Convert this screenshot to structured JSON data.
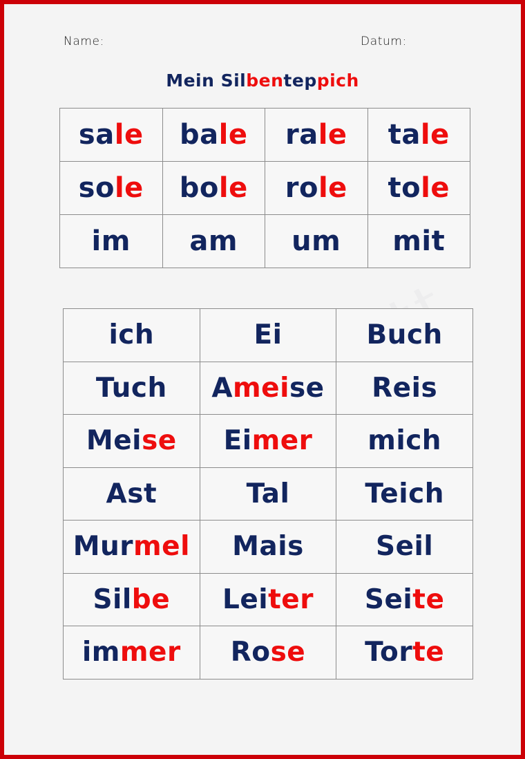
{
  "colors": {
    "page_border": "#cc0007",
    "page_background": "#f4f4f4",
    "syllable_primary": "#12255e",
    "syllable_secondary": "#ee0d0d",
    "grid_line": "#8c8c8c"
  },
  "header": {
    "name_label": "Name:",
    "date_label": "Datum:"
  },
  "title": {
    "full_text": "Mein Silbenteppich",
    "segments": [
      {
        "text": "Mein ",
        "color": "primary"
      },
      {
        "text": "Sil",
        "color": "primary"
      },
      {
        "text": "ben",
        "color": "secondary"
      },
      {
        "text": "tep",
        "color": "primary"
      },
      {
        "text": "pich",
        "color": "secondary"
      }
    ]
  },
  "tables": [
    {
      "id": "syllables",
      "columns": 4,
      "rows": [
        [
          {
            "word": "sale",
            "segments": [
              {
                "text": "sa",
                "color": "primary"
              },
              {
                "text": "le",
                "color": "secondary"
              }
            ]
          },
          {
            "word": "bale",
            "segments": [
              {
                "text": "ba",
                "color": "primary"
              },
              {
                "text": "le",
                "color": "secondary"
              }
            ]
          },
          {
            "word": "rale",
            "segments": [
              {
                "text": "ra",
                "color": "primary"
              },
              {
                "text": "le",
                "color": "secondary"
              }
            ]
          },
          {
            "word": "tale",
            "segments": [
              {
                "text": "ta",
                "color": "primary"
              },
              {
                "text": "le",
                "color": "secondary"
              }
            ]
          }
        ],
        [
          {
            "word": "sole",
            "segments": [
              {
                "text": "so",
                "color": "primary"
              },
              {
                "text": "le",
                "color": "secondary"
              }
            ]
          },
          {
            "word": "bole",
            "segments": [
              {
                "text": "bo",
                "color": "primary"
              },
              {
                "text": "le",
                "color": "secondary"
              }
            ]
          },
          {
            "word": "role",
            "segments": [
              {
                "text": "ro",
                "color": "primary"
              },
              {
                "text": "le",
                "color": "secondary"
              }
            ]
          },
          {
            "word": "tole",
            "segments": [
              {
                "text": "to",
                "color": "primary"
              },
              {
                "text": "le",
                "color": "secondary"
              }
            ]
          }
        ],
        [
          {
            "word": "im",
            "segments": [
              {
                "text": "im",
                "color": "primary"
              }
            ]
          },
          {
            "word": "am",
            "segments": [
              {
                "text": "am",
                "color": "primary"
              }
            ]
          },
          {
            "word": "um",
            "segments": [
              {
                "text": "um",
                "color": "primary"
              }
            ]
          },
          {
            "word": "mit",
            "segments": [
              {
                "text": "mit",
                "color": "primary"
              }
            ]
          }
        ]
      ]
    },
    {
      "id": "words",
      "columns": 3,
      "rows": [
        [
          {
            "word": "ich",
            "segments": [
              {
                "text": "ich",
                "color": "primary"
              }
            ]
          },
          {
            "word": "Ei",
            "segments": [
              {
                "text": "Ei",
                "color": "primary"
              }
            ]
          },
          {
            "word": "Buch",
            "segments": [
              {
                "text": "Buch",
                "color": "primary"
              }
            ]
          }
        ],
        [
          {
            "word": "Tuch",
            "segments": [
              {
                "text": "Tuch",
                "color": "primary"
              }
            ]
          },
          {
            "word": "Ameise",
            "segments": [
              {
                "text": "A",
                "color": "primary"
              },
              {
                "text": "mei",
                "color": "secondary"
              },
              {
                "text": "se",
                "color": "primary"
              }
            ]
          },
          {
            "word": "Reis",
            "segments": [
              {
                "text": "Reis",
                "color": "primary"
              }
            ]
          }
        ],
        [
          {
            "word": "Meise",
            "segments": [
              {
                "text": "Mei",
                "color": "primary"
              },
              {
                "text": "se",
                "color": "secondary"
              }
            ]
          },
          {
            "word": "Eimer",
            "segments": [
              {
                "text": "Ei",
                "color": "primary"
              },
              {
                "text": "mer",
                "color": "secondary"
              }
            ]
          },
          {
            "word": "mich",
            "segments": [
              {
                "text": "mich",
                "color": "primary"
              }
            ]
          }
        ],
        [
          {
            "word": "Ast",
            "segments": [
              {
                "text": "Ast",
                "color": "primary"
              }
            ]
          },
          {
            "word": "Tal",
            "segments": [
              {
                "text": "Tal",
                "color": "primary"
              }
            ]
          },
          {
            "word": "Teich",
            "segments": [
              {
                "text": "Teich",
                "color": "primary"
              }
            ]
          }
        ],
        [
          {
            "word": "Murmel",
            "segments": [
              {
                "text": "Mur",
                "color": "primary"
              },
              {
                "text": "mel",
                "color": "secondary"
              }
            ]
          },
          {
            "word": "Mais",
            "segments": [
              {
                "text": "Mais",
                "color": "primary"
              }
            ]
          },
          {
            "word": "Seil",
            "segments": [
              {
                "text": "Seil",
                "color": "primary"
              }
            ]
          }
        ],
        [
          {
            "word": "Silbe",
            "segments": [
              {
                "text": "Sil",
                "color": "primary"
              },
              {
                "text": "be",
                "color": "secondary"
              }
            ]
          },
          {
            "word": "Leiter",
            "segments": [
              {
                "text": "Lei",
                "color": "primary"
              },
              {
                "text": "ter",
                "color": "secondary"
              }
            ]
          },
          {
            "word": "Seite",
            "segments": [
              {
                "text": "Sei",
                "color": "primary"
              },
              {
                "text": "te",
                "color": "secondary"
              }
            ]
          }
        ],
        [
          {
            "word": "immer",
            "segments": [
              {
                "text": "im",
                "color": "primary"
              },
              {
                "text": "mer",
                "color": "secondary"
              }
            ]
          },
          {
            "word": "Rose",
            "segments": [
              {
                "text": "Ro",
                "color": "primary"
              },
              {
                "text": "se",
                "color": "secondary"
              }
            ]
          },
          {
            "word": "Torte",
            "segments": [
              {
                "text": "Tor",
                "color": "primary"
              },
              {
                "text": "te",
                "color": "secondary"
              }
            ]
          }
        ]
      ]
    }
  ]
}
